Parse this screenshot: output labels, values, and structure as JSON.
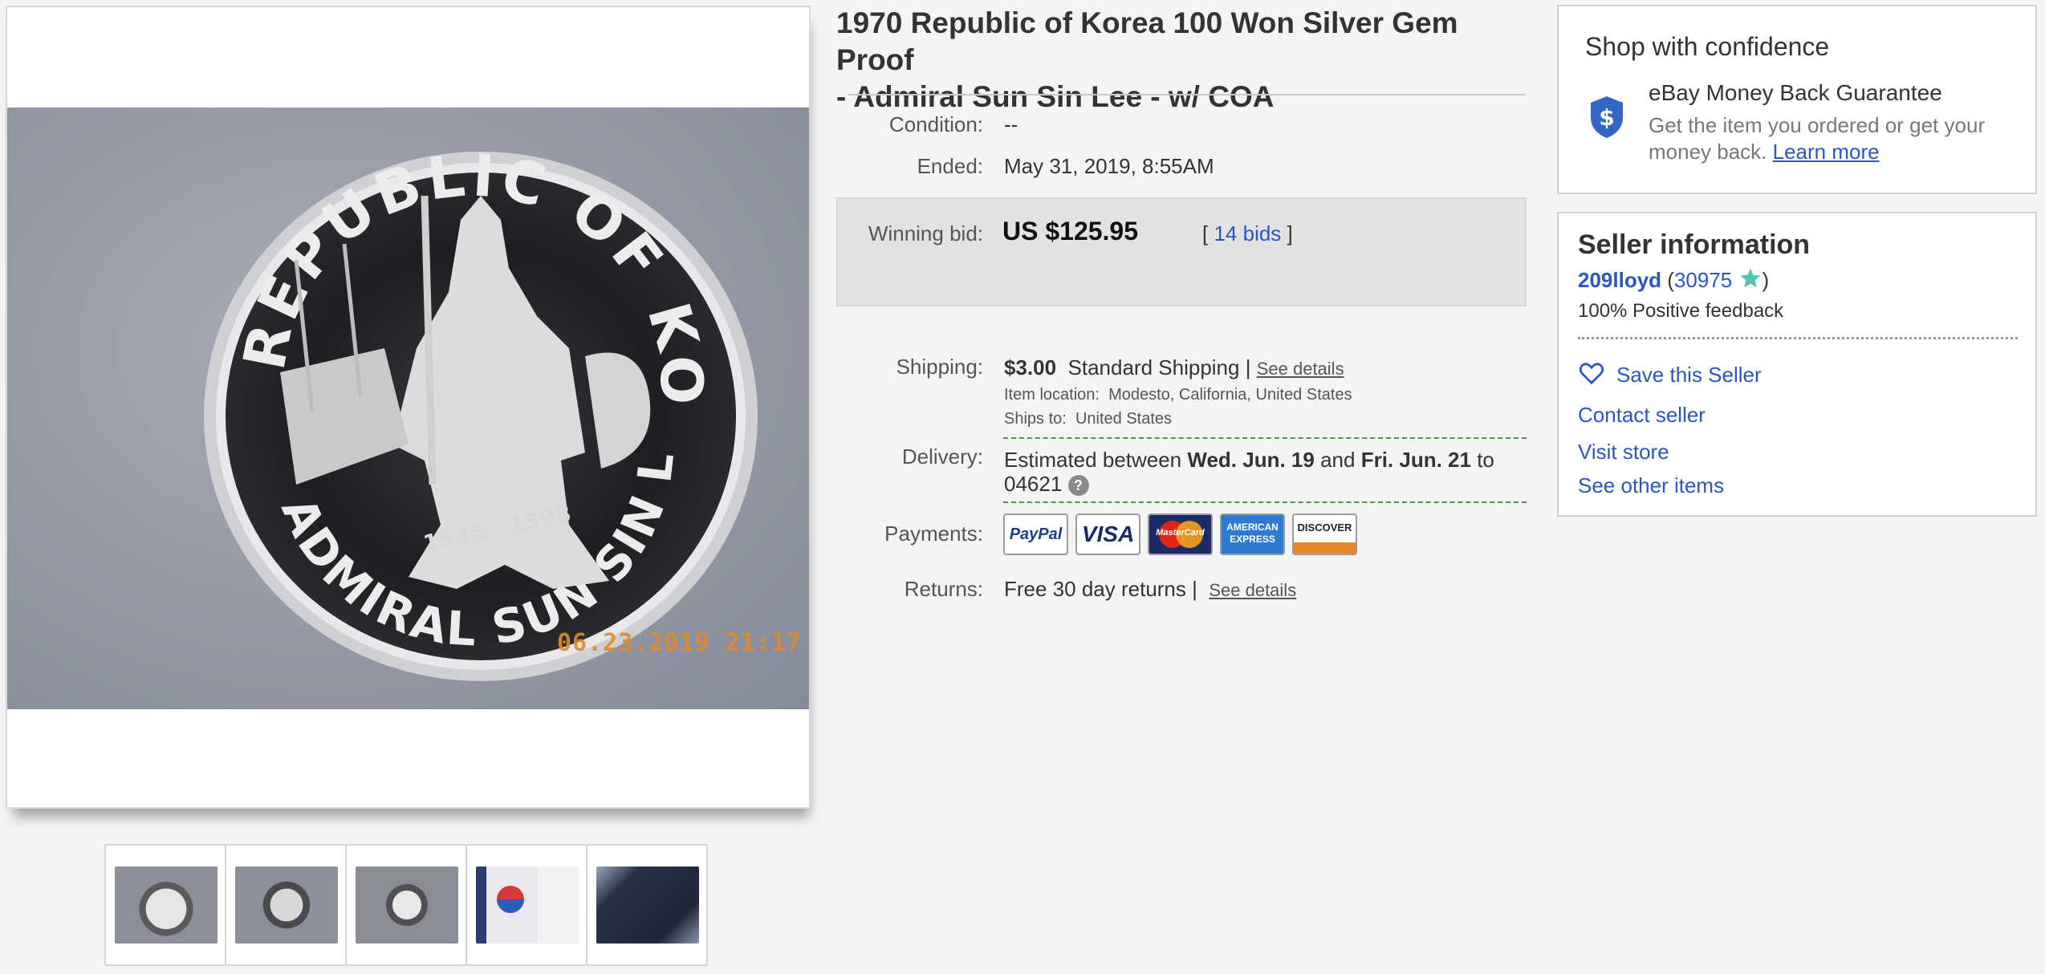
{
  "item": {
    "title_line1": "1970 Republic of Korea 100 Won Silver Gem Proof",
    "title_line2": "- Admiral Sun Sin Lee - w/ COA",
    "photo_date_stamp": "06.23.2019  21:17",
    "coin": {
      "inscription_top": "REPUBLIC OF KOREA",
      "inscription_bottom": "ADMIRAL SUN SIN LEE",
      "years": "1545 - 1598"
    },
    "thumbnails": [
      "thumb-coin-front",
      "thumb-coin-back",
      "thumb-coin-angle",
      "thumb-coa-card",
      "thumb-coin-case"
    ]
  },
  "details": {
    "condition_label": "Condition:",
    "condition_value": "--",
    "ended_label": "Ended:",
    "ended_date": "May 31, 2019",
    "ended_sep": ",",
    "ended_time": "8:55AM",
    "winning_bid_label": "Winning bid:",
    "winning_bid_value": "US $125.95",
    "bids_open": "[",
    "bids_link": "14 bids",
    "bids_close": "]",
    "shipping_label": "Shipping:",
    "shipping_cost": "$3.00",
    "shipping_method": "Standard Shipping",
    "pipe": "|",
    "see_details": "See details",
    "item_location_label": "Item location:",
    "item_location": "Modesto, California, United States",
    "ships_to_label": "Ships to:",
    "ships_to": "United States",
    "delivery_label": "Delivery:",
    "delivery_prefix": "Estimated between",
    "delivery_start": "Wed. Jun. 19",
    "delivery_and": "and",
    "delivery_end": "Fri. Jun. 21",
    "delivery_to": "to",
    "delivery_zip": "04621",
    "help_glyph": "?",
    "payments_label": "Payments:",
    "payments": {
      "paypal": "PayPal",
      "visa": "VISA",
      "mastercard": "MasterCard",
      "amex_line1": "AMERICAN",
      "amex_line2": "EXPRESS",
      "discover": "DISCOVER"
    },
    "returns_label": "Returns:",
    "returns_value": "Free 30 day returns",
    "returns_details": "See details"
  },
  "confidence": {
    "title": "Shop with confidence",
    "guarantee_title": "eBay Money Back Guarantee",
    "guarantee_text_line1": "Get the item you ordered or get your",
    "guarantee_text_line2": "money back.",
    "learn_more": "Learn more",
    "shield_glyph": "$"
  },
  "seller": {
    "title": "Seller information",
    "username": "209lloyd",
    "open_paren": "(",
    "score": "30975",
    "close_paren": ")",
    "feedback": "100% Positive feedback",
    "save_seller": "Save this Seller",
    "contact": "Contact seller",
    "visit_store": "Visit store",
    "other_items": "See other items"
  },
  "colors": {
    "link": "#2c55c6",
    "dashed_divider": "#4c9a4c",
    "star": "#4fc7b0",
    "photo_stamp": "#e08a2c"
  }
}
